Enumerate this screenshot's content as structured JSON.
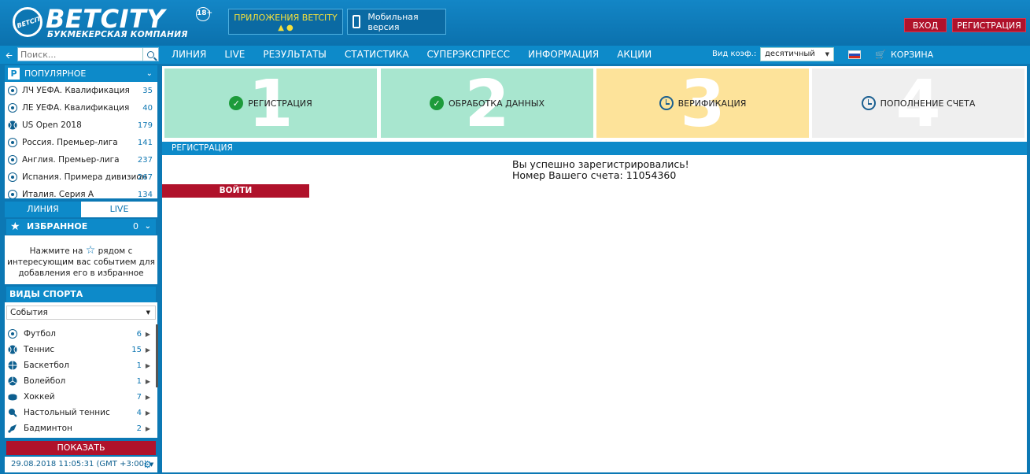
{
  "header": {
    "logo_name": "BETCITY",
    "logo_ball_text": "BETCITY",
    "logo_tagline": "БУКМЕКЕРСКАЯ КОМПАНИЯ",
    "age_badge": "18+",
    "apps_button": "ПРИЛОЖЕНИЯ BETCITY",
    "mobile_button": "Мобильная версия",
    "login_button": "ВХОД",
    "register_button": "РЕГИСТРАЦИЯ",
    "brand_blue": "#0c78b4",
    "accent_red": "#b0122b"
  },
  "nav": {
    "search_placeholder": "Поиск...",
    "menu": [
      "ЛИНИЯ",
      "LIVE",
      "РЕЗУЛЬТАТЫ",
      "СТАТИСТИКА",
      "СУПЕРЭКСПРЕСС",
      "ИНФОРМАЦИЯ",
      "АКЦИИ"
    ],
    "coef_label": "Вид коэф.:",
    "coef_value": "десятичный",
    "cart_label": "КОРЗИНА"
  },
  "sidebar": {
    "popular_title": "ПОПУЛЯРНОЕ",
    "popular": [
      {
        "label": "ЛЧ УЕФА. Квалификация",
        "count": "35",
        "icon": "soccer-ball"
      },
      {
        "label": "ЛЕ УЕФА. Квалификация",
        "count": "40",
        "icon": "soccer-ball"
      },
      {
        "label": "US Open 2018",
        "count": "179",
        "icon": "tennis-ball"
      },
      {
        "label": "Россия. Премьер-лига",
        "count": "141",
        "icon": "soccer-ball"
      },
      {
        "label": "Англия. Премьер-лига",
        "count": "237",
        "icon": "soccer-ball"
      },
      {
        "label": "Испания. Примера дивизион",
        "count": "267",
        "icon": "soccer-ball"
      },
      {
        "label": "Италия. Серия А",
        "count": "134",
        "icon": "soccer-ball"
      }
    ],
    "tab_line": "ЛИНИЯ",
    "tab_live": "LIVE",
    "favorites_title": "ИЗБРАННОЕ",
    "favorites_count": "0",
    "favorites_hint_1": "Нажмите на",
    "favorites_hint_2": "рядом с",
    "favorites_hint_3": "интересующим вас событием для",
    "favorites_hint_4": "добавления его в избранное",
    "sports_title": "ВИДЫ СПОРТА",
    "events_select": "События",
    "sports": [
      {
        "label": "Футбол",
        "count": "6",
        "icon": "soccer-ball"
      },
      {
        "label": "Теннис",
        "count": "15",
        "icon": "tennis-ball"
      },
      {
        "label": "Баскетбол",
        "count": "1",
        "icon": "basketball"
      },
      {
        "label": "Волейбол",
        "count": "1",
        "icon": "volleyball"
      },
      {
        "label": "Хоккей",
        "count": "7",
        "icon": "hockey-puck"
      },
      {
        "label": "Настольный теннис",
        "count": "4",
        "icon": "ping-pong-paddle"
      },
      {
        "label": "Бадминтон",
        "count": "2",
        "icon": "shuttlecock"
      }
    ],
    "show_button": "ПОКАЗАТЬ",
    "datetime": "29.08.2018 11:05:31 (GMT +3:00)"
  },
  "steps": [
    {
      "num": "1",
      "label": "РЕГИСТРАЦИЯ",
      "status": "done",
      "color": "#a8e6cf"
    },
    {
      "num": "2",
      "label": "ОБРАБОТКА ДАННЫХ",
      "status": "done",
      "color": "#a8e6cf"
    },
    {
      "num": "3",
      "label": "ВЕРИФИКАЦИЯ",
      "status": "pending",
      "color": "#fde39a"
    },
    {
      "num": "4",
      "label": "ПОПОЛНЕНИЕ СЧЕТА",
      "status": "pending",
      "color": "#efefef"
    }
  ],
  "main": {
    "section_title": "РЕГИСТРАЦИЯ",
    "success_line": "Вы успешно зарегистрировались!",
    "account_line": "Номер Вашего счета: 11054360",
    "login_button": "ВОЙТИ"
  }
}
